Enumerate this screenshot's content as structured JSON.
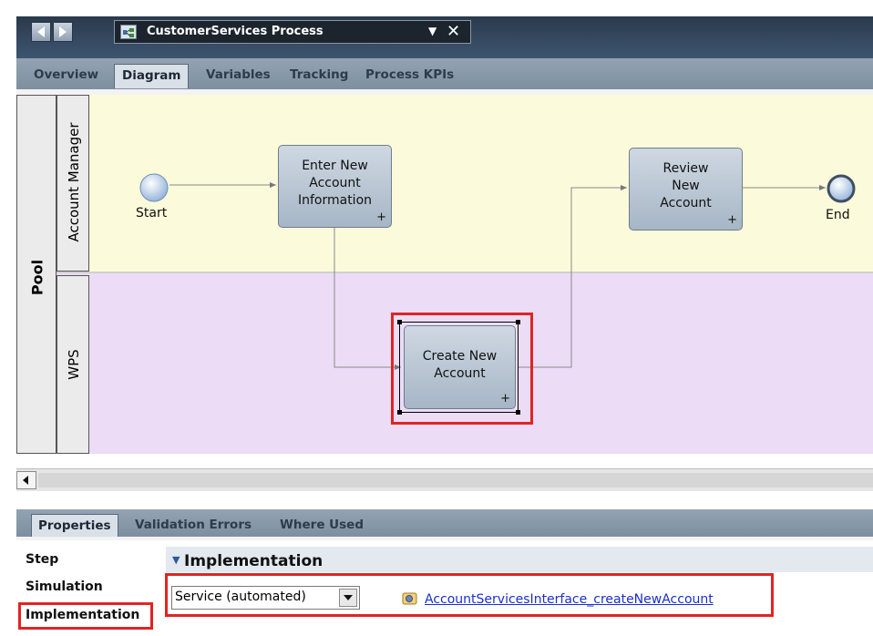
{
  "window": {
    "document_tab_title": "CustomerServices Process",
    "back_icon": "left-arrow-icon",
    "forward_icon": "right-arrow-icon",
    "dropdown_icon": "chevron-down-icon",
    "close_icon": "close-icon"
  },
  "editor_tabs": [
    {
      "label": "Overview"
    },
    {
      "label": "Diagram",
      "active": true
    },
    {
      "label": "Variables"
    },
    {
      "label": "Tracking"
    },
    {
      "label": "Process KPIs"
    }
  ],
  "diagram": {
    "pool_label": "Pool",
    "lanes": [
      {
        "label": "Account Manager",
        "color": "#fbfbdb"
      },
      {
        "label": "WPS",
        "color": "#ecdcf6"
      }
    ],
    "start_label": "Start",
    "end_label": "End",
    "tasks": [
      {
        "lines": [
          "Enter New",
          "Account",
          "Information"
        ],
        "has_subprocess_marker": true
      },
      {
        "lines": [
          "Review",
          "New",
          "Account"
        ],
        "has_subprocess_marker": true
      },
      {
        "lines": [
          "Create New",
          "Account"
        ],
        "has_subprocess_marker": true,
        "selected": true
      }
    ],
    "subprocess_marker": "+"
  },
  "properties": {
    "tabs": [
      {
        "label": "Properties",
        "active": true
      },
      {
        "label": "Validation Errors"
      },
      {
        "label": "Where Used"
      }
    ],
    "nav_items": [
      {
        "label": "Step"
      },
      {
        "label": "Simulation"
      },
      {
        "label": "Implementation",
        "selected": true
      }
    ],
    "section_title": "Implementation",
    "implementation_type": "Service (automated)",
    "service_link": "AccountServicesInterface_createNewAccount"
  },
  "colors": {
    "highlight": "#e02424",
    "link": "#1a2fd0"
  }
}
